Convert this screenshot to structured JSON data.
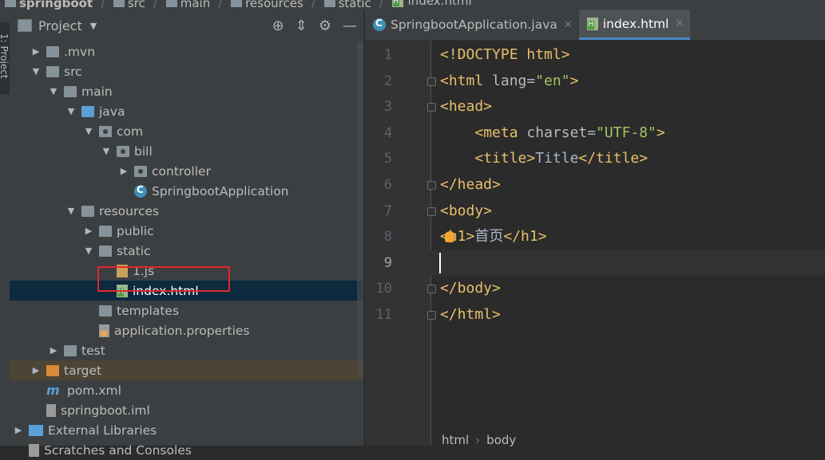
{
  "breadcrumb": [
    "springboot",
    "src",
    "main",
    "resources",
    "static",
    "index.html"
  ],
  "toolwindow_label": "1: Project",
  "panel": {
    "title": "Project"
  },
  "tree": [
    {
      "label": ".mvn",
      "icon": "folder-icon",
      "expanded": false
    },
    {
      "label": "src",
      "icon": "folder-icon",
      "expanded": true
    },
    {
      "label": "main",
      "icon": "folder-icon",
      "expanded": true
    },
    {
      "label": "java",
      "icon": "source-folder-icon",
      "expanded": true
    },
    {
      "label": "com",
      "icon": "package-icon",
      "expanded": true
    },
    {
      "label": "bill",
      "icon": "package-icon",
      "expanded": true
    },
    {
      "label": "controller",
      "icon": "package-icon",
      "expanded": false
    },
    {
      "label": "SpringbootApplication",
      "icon": "java-class-icon"
    },
    {
      "label": "resources",
      "icon": "resources-folder-icon",
      "expanded": true
    },
    {
      "label": "public",
      "icon": "folder-icon",
      "expanded": false
    },
    {
      "label": "static",
      "icon": "folder-icon",
      "expanded": true
    },
    {
      "label": "1.js",
      "icon": "js-file-icon"
    },
    {
      "label": "index.html",
      "icon": "html-file-icon",
      "selected": true
    },
    {
      "label": "templates",
      "icon": "folder-icon"
    },
    {
      "label": "application.properties",
      "icon": "properties-file-icon"
    },
    {
      "label": "test",
      "icon": "folder-icon",
      "expanded": false
    },
    {
      "label": "target",
      "icon": "excluded-folder-icon",
      "expanded": false
    },
    {
      "label": "pom.xml",
      "icon": "maven-icon"
    },
    {
      "label": "springboot.iml",
      "icon": "iml-file-icon"
    },
    {
      "label": "External Libraries",
      "icon": "libraries-icon",
      "expanded": false
    },
    {
      "label": "Scratches and Consoles",
      "icon": "scratches-icon"
    }
  ],
  "tabs": [
    {
      "label": "SpringbootApplication.java",
      "active": false
    },
    {
      "label": "index.html",
      "active": true
    }
  ],
  "code_lines": [
    {
      "n": "1",
      "parts": [
        [
          "tag",
          "<!DOCTYPE html>"
        ]
      ]
    },
    {
      "n": "2",
      "parts": [
        [
          "tag",
          "<html "
        ],
        [
          "attr",
          "lang"
        ],
        [
          "txt",
          "="
        ],
        [
          "val",
          "\"en\""
        ],
        [
          "tag",
          ">"
        ]
      ]
    },
    {
      "n": "3",
      "parts": [
        [
          "tag",
          "<head>"
        ]
      ]
    },
    {
      "n": "4",
      "parts": [
        [
          "txt",
          "    "
        ],
        [
          "tag",
          "<meta "
        ],
        [
          "attr",
          "charset"
        ],
        [
          "txt",
          "="
        ],
        [
          "val",
          "\"UTF-8\""
        ],
        [
          "tag",
          ">"
        ]
      ]
    },
    {
      "n": "5",
      "parts": [
        [
          "txt",
          "    "
        ],
        [
          "tag",
          "<title>"
        ],
        [
          "txt",
          "Title"
        ],
        [
          "tag",
          "</title>"
        ]
      ]
    },
    {
      "n": "6",
      "parts": [
        [
          "tag",
          "</head>"
        ]
      ]
    },
    {
      "n": "7",
      "parts": [
        [
          "tag",
          "<body>"
        ]
      ]
    },
    {
      "n": "8",
      "parts": [
        [
          "tag",
          "<h1>"
        ],
        [
          "txt",
          "首页"
        ],
        [
          "tag",
          "</h1>"
        ]
      ]
    },
    {
      "n": "9",
      "parts": []
    },
    {
      "n": "10",
      "parts": [
        [
          "tag",
          "</body>"
        ]
      ]
    },
    {
      "n": "11",
      "parts": [
        [
          "tag",
          "</html>"
        ]
      ]
    }
  ],
  "status_crumb": [
    "html",
    "body"
  ],
  "colors": {
    "tag": "#e8bf6a",
    "value": "#a5c261",
    "text": "#a9b7c6",
    "selection": "#0d293e",
    "highlight_box": "#e0282e"
  }
}
